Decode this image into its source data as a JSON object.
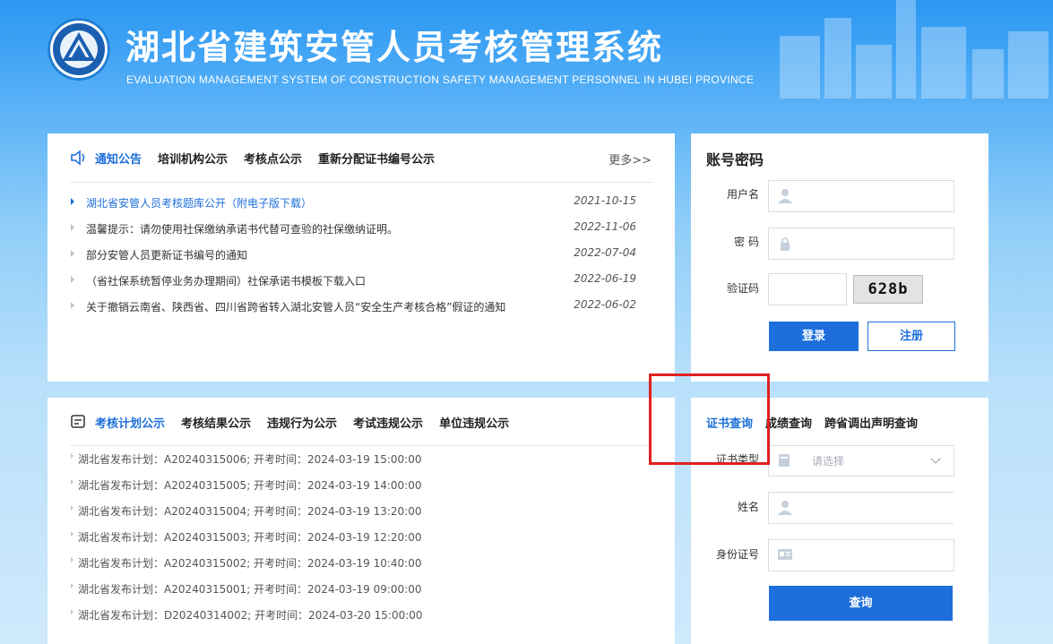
{
  "header": {
    "title_cn": "湖北省建筑安管人员考核管理系统",
    "title_en": "EVALUATION MANAGEMENT SYSTEM OF CONSTRUCTION SAFETY MANAGEMENT PERSONNEL IN HUBEI PROVINCE"
  },
  "notice": {
    "tabs": [
      "通知公告",
      "培训机构公示",
      "考核点公示",
      "重新分配证书编号公示"
    ],
    "more": "更多>>",
    "items": [
      {
        "title": "湖北省安管人员考核题库公开（附电子版下载）",
        "date": "2021-10-15"
      },
      {
        "title": "温馨提示：请勿使用社保缴纳承诺书代替可查验的社保缴纳证明。",
        "date": "2022-11-06"
      },
      {
        "title": "部分安管人员更新证书编号的通知",
        "date": "2022-07-04"
      },
      {
        "title": "（省社保系统暂停业务办理期间）社保承诺书模板下载入口",
        "date": "2022-06-19"
      },
      {
        "title": "关于撤销云南省、陕西省、四川省跨省转入湖北安管人员“安全生产考核合格”假证的通知",
        "date": "2022-06-02"
      }
    ]
  },
  "plan": {
    "tabs": [
      "考核计划公示",
      "考核结果公示",
      "违规行为公示",
      "考试违规公示",
      "单位违规公示"
    ],
    "items": [
      "湖北省发布计划：A20240315006; 开考时间：2024-03-19 15:00:00",
      "湖北省发布计划：A20240315005; 开考时间：2024-03-19 14:00:00",
      "湖北省发布计划：A20240315004; 开考时间：2024-03-19 13:20:00",
      "湖北省发布计划：A20240315003; 开考时间：2024-03-19 12:20:00",
      "湖北省发布计划：A20240315002; 开考时间：2024-03-19 10:40:00",
      "湖北省发布计划：A20240315001; 开考时间：2024-03-19 09:00:00",
      "湖北省发布计划：D20240314002; 开考时间：2024-03-20 15:00:00"
    ]
  },
  "login": {
    "title": "账号密码",
    "username_label": "用户名",
    "password_label": "密 码",
    "captcha_label": "验证码",
    "captcha_text": "628b",
    "login_button": "登录",
    "register_button": "注册"
  },
  "query": {
    "tabs": [
      "证书查询",
      "成绩查询",
      "跨省调出声明查询"
    ],
    "cert_type_label": "证书类型",
    "cert_type_placeholder": "请选择",
    "name_label": "姓名",
    "id_label": "身份证号",
    "query_button": "查询"
  },
  "colors": {
    "accent": "#1e6fdc",
    "highlight_box": "#e02020"
  }
}
